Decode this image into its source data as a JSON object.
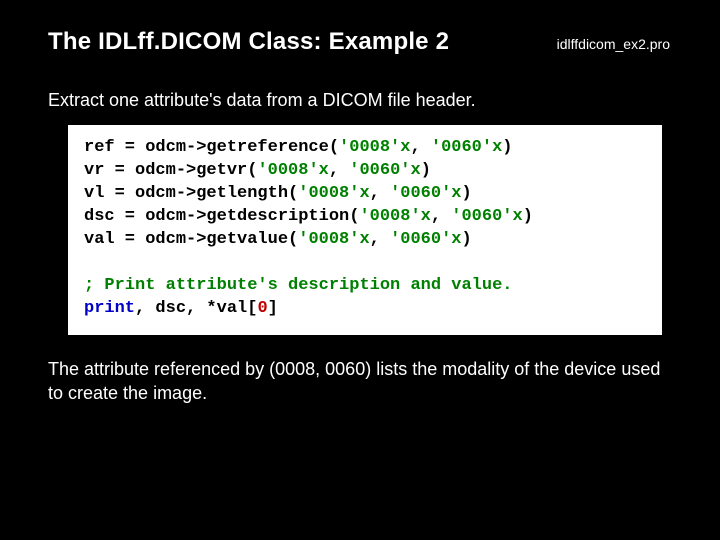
{
  "header": {
    "title": "The IDLff.DICOM Class: Example 2",
    "filename": "idlffdicom_ex2.pro"
  },
  "subtitle": "Extract one attribute's data from a DICOM file header.",
  "code": {
    "l1a": "ref = odcm->getreference(",
    "l1s1": "'0008'x",
    "l1b": ", ",
    "l1s2": "'0060'x",
    "l1c": ")",
    "l2a": "vr = odcm->getvr(",
    "l2s1": "'0008'x",
    "l2b": ", ",
    "l2s2": "'0060'x",
    "l2c": ")",
    "l3a": "vl = odcm->getlength(",
    "l3s1": "'0008'x",
    "l3b": ", ",
    "l3s2": "'0060'x",
    "l3c": ")",
    "l4a": "dsc = odcm->getdescription(",
    "l4s1": "'0008'x",
    "l4b": ", ",
    "l4s2": "'0060'x",
    "l4c": ")",
    "l5a": "val = odcm->getvalue(",
    "l5s1": "'0008'x",
    "l5b": ", ",
    "l5s2": "'0060'x",
    "l5c": ")",
    "comment": "; Print attribute's description and value.",
    "p_kw": "print",
    "p_rest1": ", dsc, *val[",
    "p_zero": "0",
    "p_rest2": "]"
  },
  "caption": "The attribute referenced by (0008, 0060) lists the modality of the device used to create the image."
}
